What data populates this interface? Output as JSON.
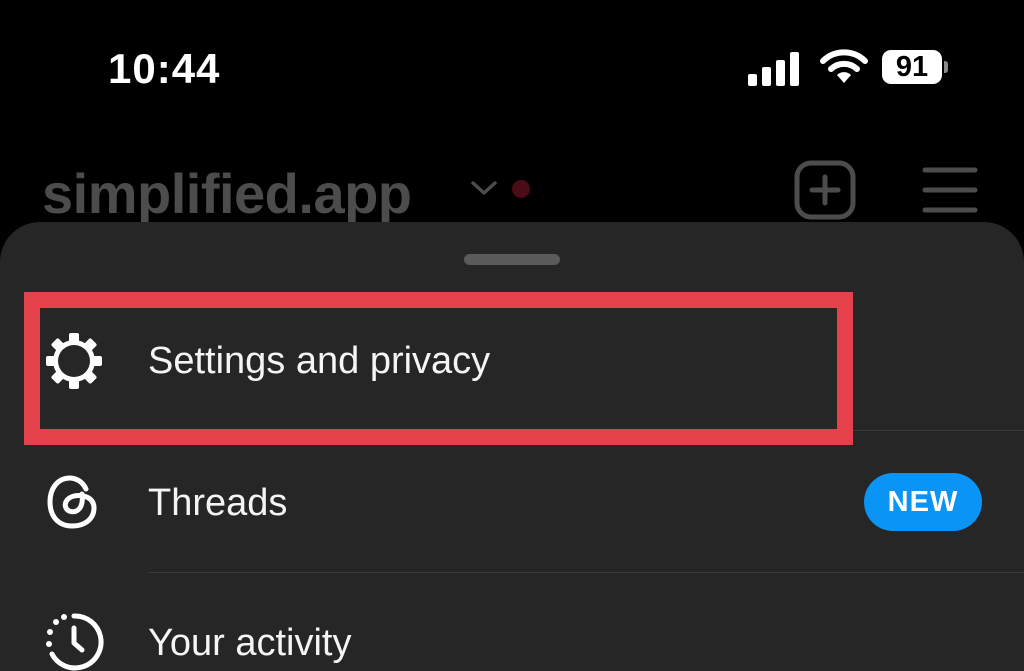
{
  "status_bar": {
    "time": "10:44",
    "battery_level": "91",
    "icons": [
      "signal-icon",
      "wifi-icon",
      "battery-icon"
    ]
  },
  "header": {
    "username": "simplified.app",
    "icons": [
      "chevron-down-icon",
      "create-post-icon",
      "hamburger-menu-icon"
    ]
  },
  "menu": {
    "items": [
      {
        "label": "Settings and privacy",
        "icon": "gear-icon",
        "highlighted": true
      },
      {
        "label": "Threads",
        "icon": "threads-icon",
        "badge": "NEW"
      },
      {
        "label": "Your activity",
        "icon": "activity-clock-icon"
      }
    ]
  },
  "colors": {
    "background": "#000000",
    "sheet": "#262626",
    "highlight": "#e5414a",
    "badge": "#0a95f6",
    "text": "#f5f5f5",
    "header_title": "#4c4c4c"
  }
}
